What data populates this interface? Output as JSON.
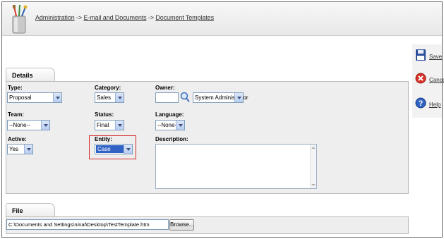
{
  "breadcrumb": {
    "items": [
      "Administration",
      "E-mail and Documents",
      "Document Templates"
    ],
    "separator": " -> "
  },
  "actions": {
    "save": "Save",
    "cancel": "Cancel",
    "help": "Help"
  },
  "tabs": {
    "details": "Details",
    "file": "File"
  },
  "form": {
    "type": {
      "label": "Type:",
      "value": "Proposal"
    },
    "category": {
      "label": "Category:",
      "value": "Sales"
    },
    "owner": {
      "label": "Owner:",
      "value": "",
      "selected": "System Administrator"
    },
    "team": {
      "label": "Team:",
      "value": "--None--"
    },
    "status": {
      "label": "Status:",
      "value": "Final"
    },
    "language": {
      "label": "Language:",
      "value": "--None--"
    },
    "active": {
      "label": "Active:",
      "value": "Yes"
    },
    "entity": {
      "label": "Entity:",
      "value": "Case"
    },
    "description": {
      "label": "Description:",
      "value": ""
    }
  },
  "file": {
    "path": "C:\\Documents and Settings\\ninal\\Desktop\\TestTemplate.htm",
    "browse_label": "Browse..."
  },
  "icons": {
    "app": "tools-jar-icon",
    "search": "magnifier-icon",
    "save": "floppy-disk-icon",
    "cancel": "cancel-icon",
    "help": "help-icon"
  },
  "colors": {
    "highlight": "#d42a2a",
    "selection": "#3163c6",
    "panel": "#eeeeee"
  }
}
